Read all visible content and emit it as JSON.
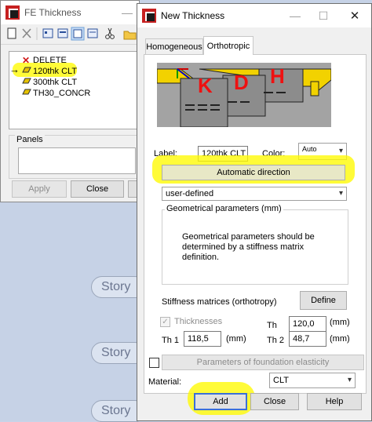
{
  "fe_window": {
    "title": "FE Thickness",
    "list_items": [
      {
        "label": "DELETE",
        "icon": "delete-x-icon"
      },
      {
        "label": "120thk CLT",
        "icon": "slab-icon",
        "current": true
      },
      {
        "label": "300thk CLT",
        "icon": "slab-icon"
      },
      {
        "label": "TH30_CONCR",
        "icon": "slab-icon"
      }
    ],
    "panels_label": "Panels",
    "apply_label": "Apply",
    "close_label": "Close"
  },
  "background": {
    "story_labels": [
      "Story",
      "Story",
      "Story"
    ]
  },
  "new_window": {
    "title": "New Thickness",
    "tabs": [
      "Homogeneous",
      "Orthotropic"
    ],
    "preview_letters": [
      "K",
      "D",
      "H"
    ],
    "label_caption": "Label:",
    "label_value": "120thk CLT",
    "color_caption": "Color:",
    "color_value": "Auto",
    "auto_direction_label": "Automatic direction",
    "mode_value": "user-defined",
    "geom_group_title": "Geometrical parameters (mm)",
    "geom_message": "Geometrical parameters should be determined by a stiffness matrix definition.",
    "stiffness_caption": "Stiffness matrices (orthotropy)",
    "define_label": "Define",
    "thicknesses_label": "Thicknesses",
    "th_label": "Th",
    "th_value": "120,0",
    "th1_label": "Th 1",
    "th1_value": "118,5",
    "th2_label": "Th 2",
    "th2_value": "48,7",
    "unit_mm": "(mm)",
    "foundation_label": "Parameters of foundation elasticity",
    "material_caption": "Material:",
    "material_value": "CLT",
    "add_label": "Add",
    "close_label": "Close",
    "help_label": "Help"
  },
  "colors": {
    "highlight": "#fff700",
    "title_red": "#c62020"
  }
}
